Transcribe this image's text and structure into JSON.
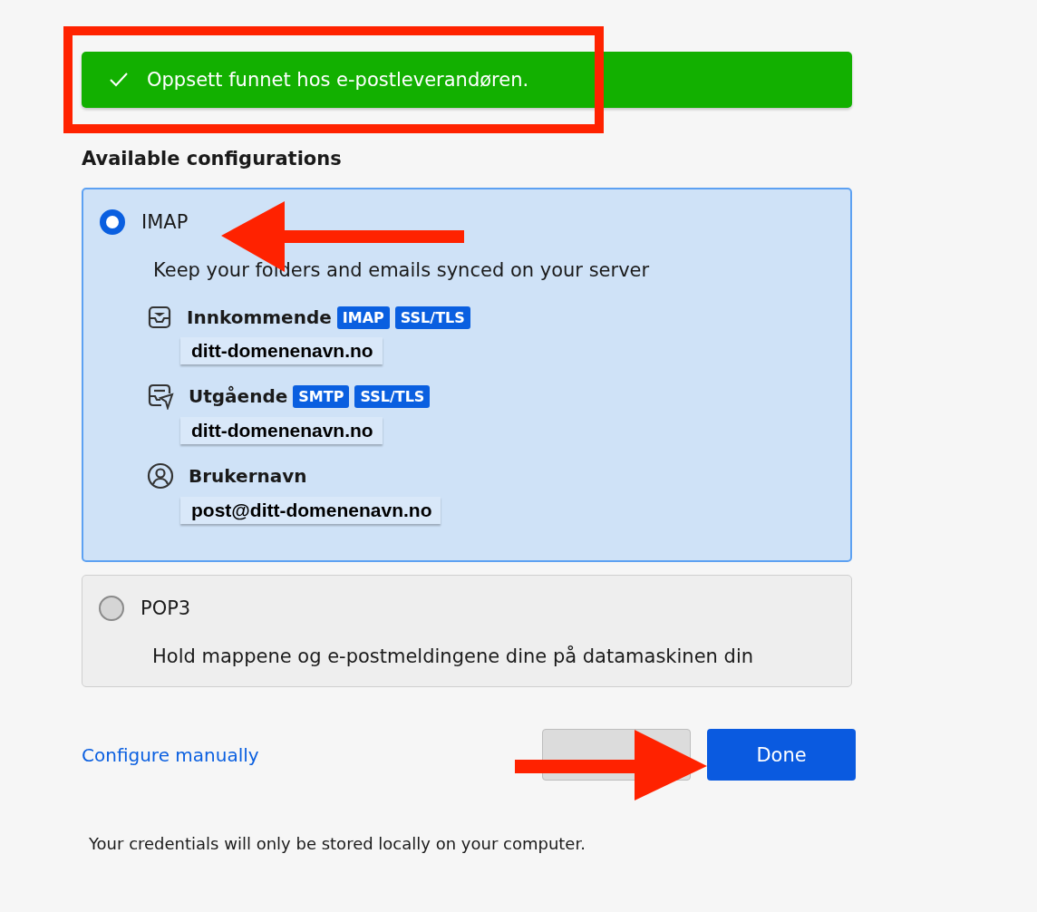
{
  "banner": {
    "text": "Oppsett funnet hos e-postleverandøren."
  },
  "heading": "Available configurations",
  "configurations": [
    {
      "name": "IMAP",
      "description": "Keep your folders and emails synced on your server",
      "selected": true,
      "details": [
        {
          "kind": "incoming",
          "label": "Innkommende",
          "tags": [
            "IMAP",
            "SSL/TLS"
          ],
          "value": "ditt-domenenavn.no"
        },
        {
          "kind": "outgoing",
          "label": "Utgående",
          "tags": [
            "SMTP",
            "SSL/TLS"
          ],
          "value": "ditt-domenenavn.no"
        },
        {
          "kind": "username",
          "label": "Brukernavn",
          "value": "post@ditt-domenenavn.no"
        }
      ]
    },
    {
      "name": "POP3",
      "description": "Hold mappene og e-postmeldingene dine på datamaskinen din",
      "selected": false
    }
  ],
  "configure_link": "Configure manually",
  "buttons": [
    {
      "kind": "secondary"
    },
    {
      "label": "Done",
      "kind": "primary"
    }
  ],
  "note": "Your credentials will only be stored locally on your computer."
}
